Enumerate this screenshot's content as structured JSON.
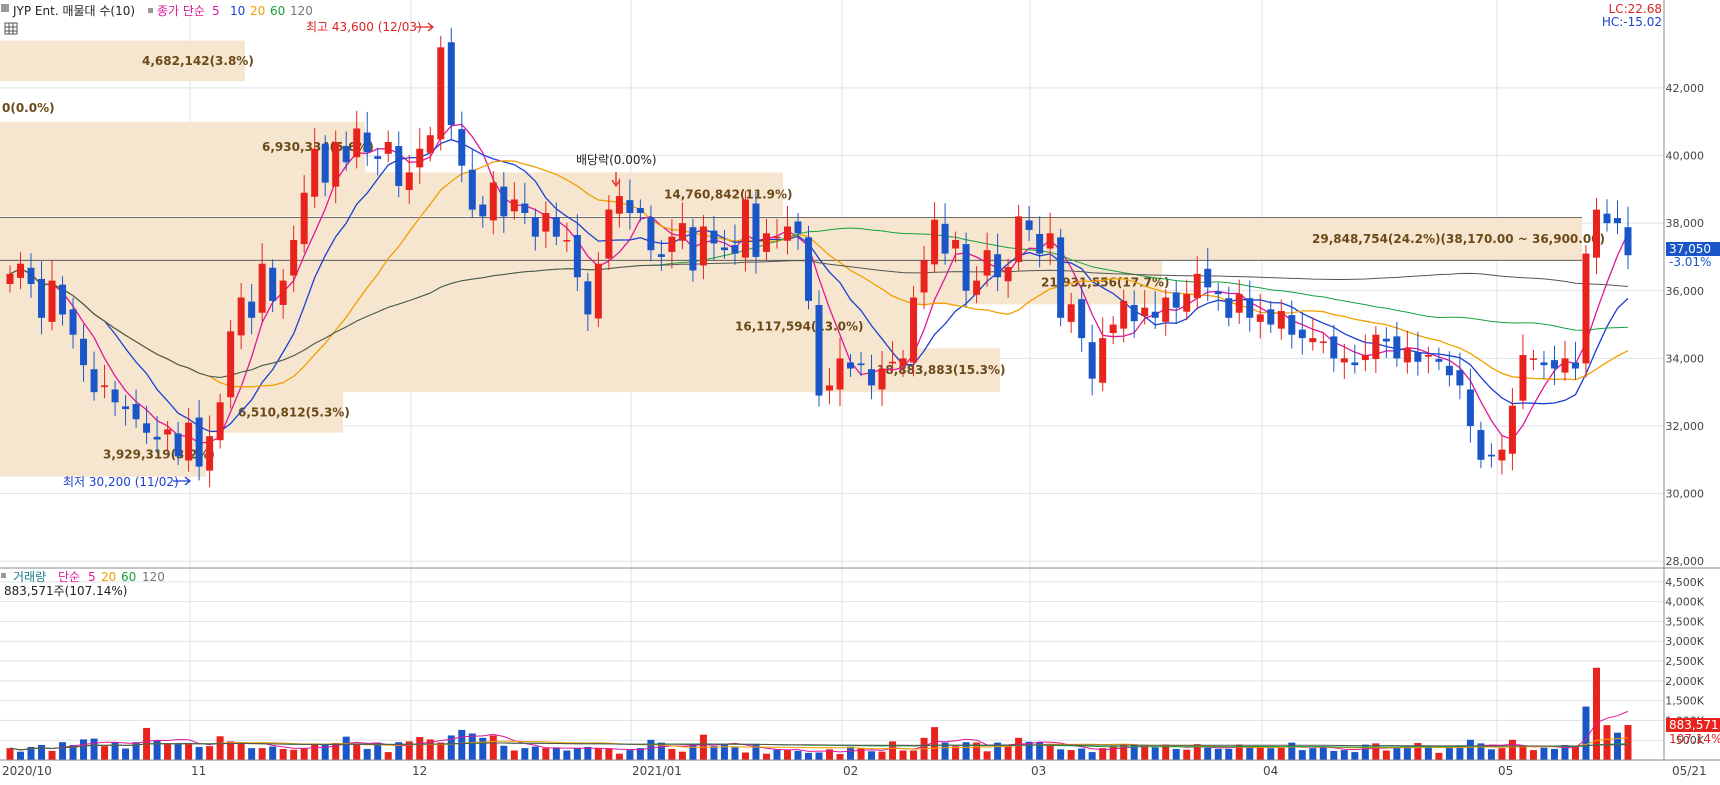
{
  "header": {
    "title": "JYP Ent. 매물대 수(10)",
    "ma_label": "종가 단순",
    "ma_periods": [
      "5",
      "10",
      "20",
      "60",
      "120"
    ],
    "ma_colors": [
      "#e0169a",
      "#1b3fd1",
      "#f0a000",
      "#15a13a",
      "#555555"
    ],
    "lc": "LC:22.68",
    "hc": "HC:-15.02",
    "last_price": "37,050",
    "last_change": "-3.01%"
  },
  "volume_header": {
    "title": "거래량",
    "ma_label": "단순",
    "ma_periods": [
      "5",
      "20",
      "60",
      "120"
    ],
    "last_volume": "883,571주(107.14%)",
    "last_volume_tag": "883,571",
    "last_ratio_tag": "107.14%"
  },
  "markers": {
    "high": "최고 43,600 (12/03)",
    "low": "최저 30,200 (11/02)",
    "dividend": "배당락(0.00%)"
  },
  "volume_profile": [
    {
      "label": "4,682,142(3.8%)",
      "lo": 42200,
      "hi": 43400
    },
    {
      "label": "0(0.0%)",
      "lo": 41400,
      "hi": 41400
    },
    {
      "label": "6,930,334(5.6%)",
      "lo": 39500,
      "hi": 41000
    },
    {
      "label": "14,760,842(11.9%)",
      "lo": 38200,
      "hi": 39500
    },
    {
      "label": "29,848,754(24.2%)(38,170.00 ~ 36,900.00)",
      "lo": 36900,
      "hi": 38170
    },
    {
      "label": "21,931,556(17.7%)",
      "lo": 35600,
      "hi": 36900
    },
    {
      "label": "16,117,594(13.0%)",
      "lo": 34300,
      "hi": 35600
    },
    {
      "label": "18,883,883(15.3%)",
      "lo": 33000,
      "hi": 34300
    },
    {
      "label": "6,510,812(5.3%)",
      "lo": 31800,
      "hi": 33000
    },
    {
      "label": "3,929,319(3.2%)",
      "lo": 30500,
      "hi": 31800
    }
  ],
  "chart_data": [
    {
      "type": "candlestick",
      "title": "JYP Ent.",
      "x_labels": [
        "2020/10",
        "11",
        "12",
        "2021/01",
        "02",
        "03",
        "04",
        "05",
        "05/21"
      ],
      "y_ticks": [
        "28,000",
        "30,000",
        "32,000",
        "34,000",
        "36,000",
        "38,000",
        "40,000",
        "42,000"
      ],
      "ylim": [
        27800,
        44600
      ],
      "close": [
        36500,
        36800,
        36200,
        35200,
        36300,
        35300,
        34700,
        33800,
        33000,
        33200,
        32700,
        32500,
        32200,
        31800,
        31600,
        31900,
        31100,
        32100,
        30800,
        31700,
        32700,
        34800,
        35800,
        35200,
        36800,
        35700,
        36300,
        37500,
        38900,
        40200,
        39200,
        40400,
        39800,
        40800,
        40100,
        39900,
        40400,
        39100,
        39500,
        40200,
        40600,
        43200,
        40900,
        39700,
        38400,
        38200,
        39200,
        38200,
        38700,
        38300,
        37600,
        38300,
        37600,
        37500,
        36400,
        35300,
        36800,
        38400,
        38800,
        38300,
        38300,
        37200,
        37000,
        37600,
        38000,
        36600,
        37900,
        37400,
        37200,
        37100,
        38700,
        37000,
        37700,
        37600,
        37900,
        37700,
        35700,
        32900,
        33200,
        34000,
        33700,
        33800,
        33200,
        33700,
        33900,
        34000,
        35800,
        36900,
        38100,
        37100,
        37500,
        36000,
        36300,
        37200,
        36400,
        36700,
        38200,
        37800,
        37100,
        37700,
        35200,
        35600,
        34600,
        33400,
        34600,
        35000,
        35700,
        35100,
        35500,
        35200,
        35800,
        35500,
        35900,
        36500,
        36100,
        35900,
        35200,
        35900,
        35200,
        35300,
        35000,
        35400,
        34700,
        34600,
        34600,
        34500,
        34000,
        34000,
        33800,
        34100,
        34700,
        34500,
        34000,
        34300,
        33900,
        34100,
        33900,
        33500,
        33200,
        32000,
        31000,
        31100,
        31300,
        32600,
        34100,
        34000,
        33800,
        33700,
        34000,
        33700,
        37100,
        38400,
        38000,
        38000,
        37050
      ]
    },
    {
      "type": "bar",
      "title": "거래량",
      "y_ticks": [
        "500K",
        "1,000K",
        "1,500K",
        "2,000K",
        "2,500K",
        "3,000K",
        "3,500K",
        "4,000K",
        "4,500K"
      ],
      "ylim": [
        0,
        4850000
      ],
      "values": [
        300000,
        210000,
        330000,
        380000,
        230000,
        450000,
        380000,
        520000,
        540000,
        350000,
        450000,
        290000,
        450000,
        810000,
        490000,
        420000,
        420000,
        420000,
        330000,
        350000,
        600000,
        470000,
        440000,
        300000,
        300000,
        340000,
        280000,
        260000,
        290000,
        400000,
        380000,
        430000,
        590000,
        420000,
        280000,
        440000,
        200000,
        450000,
        470000,
        580000,
        520000,
        440000,
        620000,
        760000,
        670000,
        560000,
        620000,
        360000,
        240000,
        300000,
        340000,
        300000,
        320000,
        240000,
        300000,
        330000,
        300000,
        280000,
        160000,
        250000,
        300000,
        510000,
        440000,
        280000,
        210000,
        390000,
        640000,
        350000,
        410000,
        320000,
        190000,
        410000,
        160000,
        260000,
        260000,
        230000,
        180000,
        190000,
        270000,
        150000,
        330000,
        300000,
        220000,
        210000,
        470000,
        240000,
        240000,
        560000,
        830000,
        440000,
        350000,
        450000,
        440000,
        220000,
        440000,
        360000,
        560000,
        460000,
        450000,
        410000,
        270000,
        250000,
        290000,
        200000,
        300000,
        350000,
        400000,
        380000,
        370000,
        320000,
        390000,
        280000,
        260000,
        400000,
        310000,
        280000,
        280000,
        390000,
        310000,
        320000,
        300000,
        310000,
        440000,
        250000,
        300000,
        330000,
        230000,
        250000,
        200000,
        390000,
        420000,
        240000,
        320000,
        350000,
        430000,
        350000,
        180000,
        330000,
        370000,
        510000,
        420000,
        270000,
        300000,
        510000,
        340000,
        250000,
        310000,
        280000,
        380000,
        340000,
        1350000,
        2330000,
        880000,
        690000,
        883571
      ],
      "price_change": [
        1,
        -1,
        -1,
        -1,
        1,
        -1,
        -1,
        -1,
        -1,
        1,
        -1,
        -1,
        -1,
        1,
        -1,
        1,
        -1,
        1,
        -1,
        1,
        1,
        1,
        1,
        -1,
        1,
        -1,
        1,
        1,
        1,
        1,
        -1,
        1,
        -1,
        1,
        -1,
        -1,
        1,
        -1,
        1,
        1,
        1,
        1,
        -1,
        -1,
        -1,
        -1,
        1,
        -1,
        1,
        -1,
        -1,
        1,
        -1,
        -1,
        -1,
        -1,
        1,
        1,
        1,
        -1,
        -1,
        -1,
        -1,
        1,
        1,
        -1,
        1,
        -1,
        -1,
        -1,
        1,
        -1,
        1,
        -1,
        1,
        -1,
        -1,
        -1,
        1,
        1,
        -1,
        1,
        -1,
        1,
        1,
        1,
        1,
        1,
        1,
        -1,
        1,
        -1,
        1,
        1,
        -1,
        1,
        1,
        -1,
        -1,
        1,
        -1,
        1,
        -1,
        -1,
        1,
        1,
        1,
        -1,
        1,
        -1,
        1,
        -1,
        1,
        1,
        -1,
        -1,
        -1,
        1,
        -1,
        1,
        -1,
        1,
        -1,
        -1,
        -1,
        -1,
        -1,
        -1,
        -1,
        -1,
        1,
        1,
        -1,
        -1,
        1,
        -1,
        1,
        -1,
        -1,
        -1,
        -1,
        -1,
        1,
        1,
        1,
        1,
        -1,
        -1,
        -1,
        1,
        -1,
        1,
        1,
        -1,
        1,
        -1
      ]
    }
  ],
  "colors": {
    "up": "#e8221c",
    "down": "#1a56c8",
    "profile_fill": "#f7e6cf",
    "grid": "#dde2ea",
    "axis_text": "#444444"
  }
}
